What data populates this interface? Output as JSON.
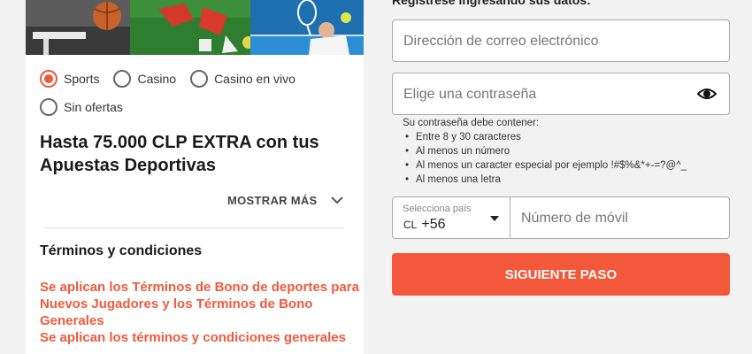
{
  "offers": {
    "options": [
      {
        "label": "Sports",
        "selected": true
      },
      {
        "label": "Casino",
        "selected": false
      },
      {
        "label": "Casino en vivo",
        "selected": false
      },
      {
        "label": "Sin ofertas",
        "selected": false
      }
    ],
    "headline": "Hasta 75.000 CLP EXTRA con tus Apuestas Deportivas",
    "more_label": "MOSTRAR MÁS",
    "terms_title": "Términos y condiciones",
    "terms_link_1": "Se aplican los Términos de Bono de deportes para Nuevos Jugadores y los Términos de Bono Generales",
    "terms_link_2": "Se aplican los términos y condiciones generales",
    "accent_color": "#f05a3c"
  },
  "form": {
    "heading": "Registrese ingresando sus datos:",
    "email_placeholder": "Dirección de correo electrónico",
    "password_placeholder": "Elige una contraseña",
    "password_hint_title": "Su contraseña debe contener:",
    "password_rules": [
      "Entre 8 y 30 caracteres",
      "Al menos un número",
      "Al menos un caracter especial por ejemplo !#$%&*+-=?@^_",
      "Al menos una letra"
    ],
    "country_label": "Selecciona país",
    "country_flag": "CL",
    "country_code": "+56",
    "mobile_placeholder": "Número de móvil",
    "submit_label": "SIGUIENTE PASO",
    "button_color": "#f4583a"
  }
}
